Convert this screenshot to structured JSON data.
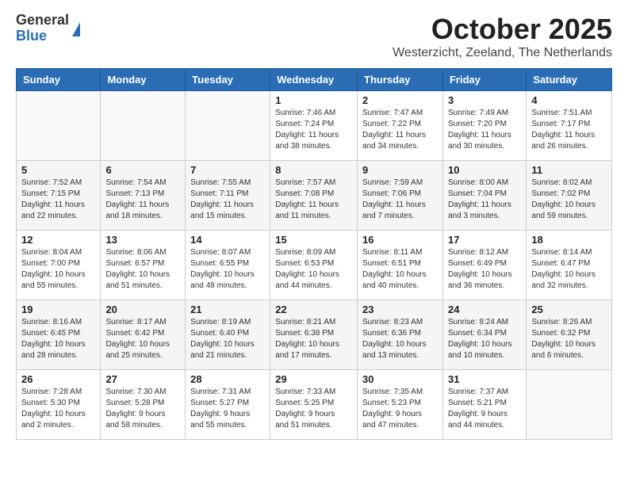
{
  "logo": {
    "general": "General",
    "blue": "Blue"
  },
  "header": {
    "title": "October 2025",
    "subtitle": "Westerzicht, Zeeland, The Netherlands"
  },
  "weekdays": [
    "Sunday",
    "Monday",
    "Tuesday",
    "Wednesday",
    "Thursday",
    "Friday",
    "Saturday"
  ],
  "weeks": [
    [
      {
        "day": "",
        "info": ""
      },
      {
        "day": "",
        "info": ""
      },
      {
        "day": "",
        "info": ""
      },
      {
        "day": "1",
        "info": "Sunrise: 7:46 AM\nSunset: 7:24 PM\nDaylight: 11 hours\nand 38 minutes."
      },
      {
        "day": "2",
        "info": "Sunrise: 7:47 AM\nSunset: 7:22 PM\nDaylight: 11 hours\nand 34 minutes."
      },
      {
        "day": "3",
        "info": "Sunrise: 7:49 AM\nSunset: 7:20 PM\nDaylight: 11 hours\nand 30 minutes."
      },
      {
        "day": "4",
        "info": "Sunrise: 7:51 AM\nSunset: 7:17 PM\nDaylight: 11 hours\nand 26 minutes."
      }
    ],
    [
      {
        "day": "5",
        "info": "Sunrise: 7:52 AM\nSunset: 7:15 PM\nDaylight: 11 hours\nand 22 minutes."
      },
      {
        "day": "6",
        "info": "Sunrise: 7:54 AM\nSunset: 7:13 PM\nDaylight: 11 hours\nand 18 minutes."
      },
      {
        "day": "7",
        "info": "Sunrise: 7:55 AM\nSunset: 7:11 PM\nDaylight: 11 hours\nand 15 minutes."
      },
      {
        "day": "8",
        "info": "Sunrise: 7:57 AM\nSunset: 7:08 PM\nDaylight: 11 hours\nand 11 minutes."
      },
      {
        "day": "9",
        "info": "Sunrise: 7:59 AM\nSunset: 7:06 PM\nDaylight: 11 hours\nand 7 minutes."
      },
      {
        "day": "10",
        "info": "Sunrise: 8:00 AM\nSunset: 7:04 PM\nDaylight: 11 hours\nand 3 minutes."
      },
      {
        "day": "11",
        "info": "Sunrise: 8:02 AM\nSunset: 7:02 PM\nDaylight: 10 hours\nand 59 minutes."
      }
    ],
    [
      {
        "day": "12",
        "info": "Sunrise: 8:04 AM\nSunset: 7:00 PM\nDaylight: 10 hours\nand 55 minutes."
      },
      {
        "day": "13",
        "info": "Sunrise: 8:06 AM\nSunset: 6:57 PM\nDaylight: 10 hours\nand 51 minutes."
      },
      {
        "day": "14",
        "info": "Sunrise: 8:07 AM\nSunset: 6:55 PM\nDaylight: 10 hours\nand 48 minutes."
      },
      {
        "day": "15",
        "info": "Sunrise: 8:09 AM\nSunset: 6:53 PM\nDaylight: 10 hours\nand 44 minutes."
      },
      {
        "day": "16",
        "info": "Sunrise: 8:11 AM\nSunset: 6:51 PM\nDaylight: 10 hours\nand 40 minutes."
      },
      {
        "day": "17",
        "info": "Sunrise: 8:12 AM\nSunset: 6:49 PM\nDaylight: 10 hours\nand 36 minutes."
      },
      {
        "day": "18",
        "info": "Sunrise: 8:14 AM\nSunset: 6:47 PM\nDaylight: 10 hours\nand 32 minutes."
      }
    ],
    [
      {
        "day": "19",
        "info": "Sunrise: 8:16 AM\nSunset: 6:45 PM\nDaylight: 10 hours\nand 28 minutes."
      },
      {
        "day": "20",
        "info": "Sunrise: 8:17 AM\nSunset: 6:42 PM\nDaylight: 10 hours\nand 25 minutes."
      },
      {
        "day": "21",
        "info": "Sunrise: 8:19 AM\nSunset: 6:40 PM\nDaylight: 10 hours\nand 21 minutes."
      },
      {
        "day": "22",
        "info": "Sunrise: 8:21 AM\nSunset: 6:38 PM\nDaylight: 10 hours\nand 17 minutes."
      },
      {
        "day": "23",
        "info": "Sunrise: 8:23 AM\nSunset: 6:36 PM\nDaylight: 10 hours\nand 13 minutes."
      },
      {
        "day": "24",
        "info": "Sunrise: 8:24 AM\nSunset: 6:34 PM\nDaylight: 10 hours\nand 10 minutes."
      },
      {
        "day": "25",
        "info": "Sunrise: 8:26 AM\nSunset: 6:32 PM\nDaylight: 10 hours\nand 6 minutes."
      }
    ],
    [
      {
        "day": "26",
        "info": "Sunrise: 7:28 AM\nSunset: 5:30 PM\nDaylight: 10 hours\nand 2 minutes."
      },
      {
        "day": "27",
        "info": "Sunrise: 7:30 AM\nSunset: 5:28 PM\nDaylight: 9 hours\nand 58 minutes."
      },
      {
        "day": "28",
        "info": "Sunrise: 7:31 AM\nSunset: 5:27 PM\nDaylight: 9 hours\nand 55 minutes."
      },
      {
        "day": "29",
        "info": "Sunrise: 7:33 AM\nSunset: 5:25 PM\nDaylight: 9 hours\nand 51 minutes."
      },
      {
        "day": "30",
        "info": "Sunrise: 7:35 AM\nSunset: 5:23 PM\nDaylight: 9 hours\nand 47 minutes."
      },
      {
        "day": "31",
        "info": "Sunrise: 7:37 AM\nSunset: 5:21 PM\nDaylight: 9 hours\nand 44 minutes."
      },
      {
        "day": "",
        "info": ""
      }
    ]
  ]
}
